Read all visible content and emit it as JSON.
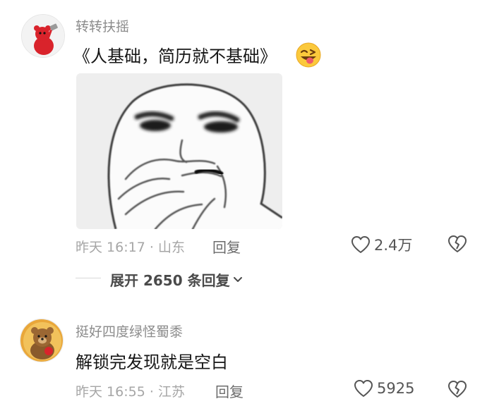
{
  "comments": [
    {
      "username": "转转扶摇",
      "text": "《人基础，简历就不基础》",
      "emoji_icon": "winking-tongue-emoji-icon",
      "sticker_icon": "covering-mouth-laughing-meme-sticker",
      "time": "昨天 16:17",
      "separator": "·",
      "location": "山东",
      "reply_label": "回复",
      "likes": "2.4万"
    },
    {
      "username": "挺好四度绿怪蜀黍",
      "text": "解锁完发现就是空白",
      "time": "昨天 16:55",
      "separator": "·",
      "location": "江苏",
      "reply_label": "回复",
      "likes": "5925"
    }
  ],
  "expand_replies": {
    "label": "展开 2650 条回复",
    "icon": "chevron-down-icon"
  },
  "colors": {
    "meta_text": "#a6a6a6",
    "username": "#8c8c8c",
    "body_text": "#161616",
    "icon_stroke": "#555555"
  }
}
